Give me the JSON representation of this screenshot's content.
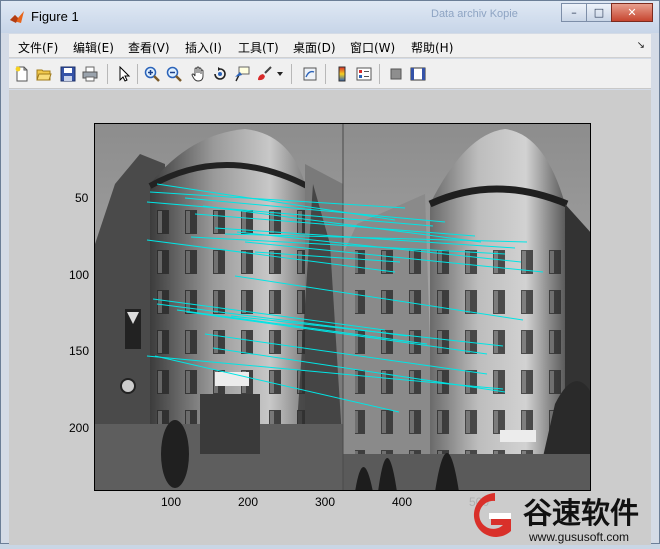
{
  "window": {
    "title": "Figure 1",
    "background_hint": "Data archiv Kopie",
    "controls": {
      "minimize": "–",
      "maximize": "□",
      "close": "✕"
    }
  },
  "menu": {
    "items": [
      "文件(F)",
      "编辑(E)",
      "查看(V)",
      "插入(I)",
      "工具(T)",
      "桌面(D)",
      "窗口(W)",
      "帮助(H)"
    ],
    "overflow_arrow": "↘"
  },
  "toolbar": {
    "icons": [
      "new-figure-icon",
      "open-folder-icon",
      "save-icon",
      "print-icon",
      "pointer-icon",
      "zoom-in-icon",
      "zoom-out-icon",
      "pan-hand-icon",
      "rotate-3d-icon",
      "data-cursor-icon",
      "brush-icon",
      "dropdown-arrow-icon",
      "link-plot-icon",
      "colorbar-icon",
      "legend-icon",
      "hide-plot-tools-icon",
      "show-plot-tools-icon"
    ]
  },
  "axes": {
    "y_ticks": [
      "50",
      "100",
      "150",
      "200"
    ],
    "x_ticks": [
      "100",
      "200",
      "300",
      "400"
    ],
    "partial_x_tick": "500"
  },
  "colors": {
    "match_lines": "#00e5e5",
    "accent_orange": "#e8641a",
    "watermark_red": "#d9302a"
  },
  "watermark": {
    "brand": "谷速软件",
    "url": "www.gususoft.com"
  }
}
